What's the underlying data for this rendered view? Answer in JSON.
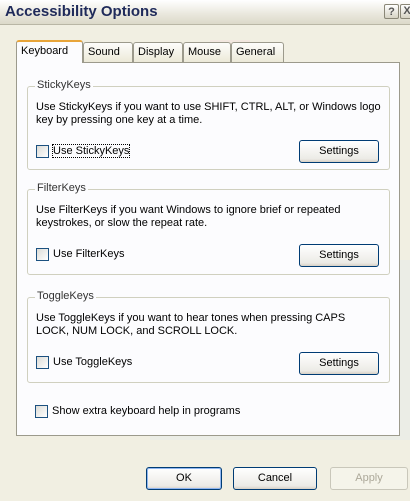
{
  "window": {
    "title": "Accessibility Options",
    "help_label": "?",
    "close_label": "X"
  },
  "tabs": [
    {
      "label": "Keyboard",
      "active": true
    },
    {
      "label": "Sound",
      "active": false
    },
    {
      "label": "Display",
      "active": false
    },
    {
      "label": "Mouse",
      "active": false
    },
    {
      "label": "General",
      "active": false
    }
  ],
  "sticky": {
    "legend": "StickyKeys",
    "description": "Use StickyKeys if you want to use SHIFT, CTRL, ALT, or Windows logo key by pressing one key at a time.",
    "checkbox_label": "Use StickyKeys",
    "checked": false,
    "settings_label": "Settings"
  },
  "filter": {
    "legend": "FilterKeys",
    "description": "Use FilterKeys if you want Windows to ignore brief or repeated keystrokes, or slow the repeat rate.",
    "checkbox_label": "Use FilterKeys",
    "checked": false,
    "settings_label": "Settings"
  },
  "toggle": {
    "legend": "ToggleKeys",
    "description": "Use ToggleKeys if you want to hear tones when pressing CAPS LOCK, NUM LOCK, and SCROLL LOCK.",
    "checkbox_label": "Use ToggleKeys",
    "checked": false,
    "settings_label": "Settings"
  },
  "extra_help": {
    "label": "Show extra keyboard help in programs",
    "checked": false
  },
  "footer": {
    "ok_label": "OK",
    "cancel_label": "Cancel",
    "apply_label": "Apply"
  },
  "colors": {
    "dialog_bg": "#f1efe2",
    "panel_bg": "#fcfcfe",
    "active_tab_accent": "#e8a53a",
    "button_border": "#003c74",
    "title_text": "#1f2a5a"
  }
}
